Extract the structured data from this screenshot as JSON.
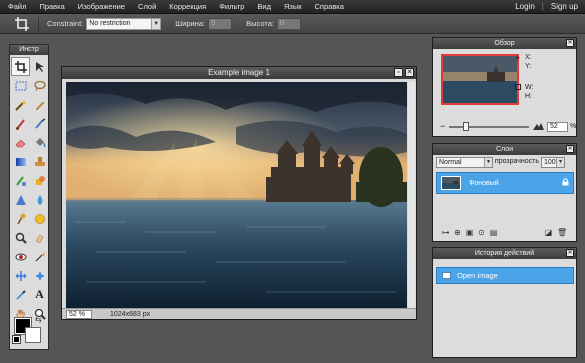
{
  "menu": {
    "items": [
      "Файл",
      "Правка",
      "Изображение",
      "Слой",
      "Коррекция",
      "Фильтр",
      "Вид",
      "Язык",
      "Справка"
    ],
    "login": "Login",
    "separator": "|",
    "signup": "Sign up"
  },
  "options": {
    "constraint_label": "Constraint:",
    "constraint_value": "No restriction",
    "width_label": "Ширина:",
    "width_value": "0",
    "height_label": "Высота:",
    "height_value": "0"
  },
  "tools": {
    "title": "Инстр",
    "icons": [
      "crop-icon",
      "move-icon",
      "marquee-icon",
      "lasso-icon",
      "wand-icon",
      "pencil-icon",
      "brush-icon",
      "clone-icon",
      "eraser-icon",
      "bucket-icon",
      "gradient-icon",
      "stamp-icon",
      "color-replace-icon",
      "drawing-icon",
      "sharpen-icon",
      "blur-icon",
      "dodge-icon",
      "burn-icon",
      "sponge-icon",
      "smudge-icon",
      "eyedropper-icon",
      "spot-heal-icon",
      "red-eye-icon",
      "bloat-icon",
      "pinch-icon",
      "text-icon",
      "hand-icon",
      "zoom-icon",
      "line-icon",
      "type-icon"
    ],
    "foreground_color": "#000000",
    "background_color": "#ffffff"
  },
  "image_window": {
    "title": "Example image 1",
    "zoom": "52",
    "zoom_unit": "%",
    "dimensions": "1024x683 px"
  },
  "navigator": {
    "title": "Обзор",
    "x_label": "X:",
    "y_label": "Y:",
    "w_label": "W:",
    "h_label": "H:",
    "zoom": "52",
    "zoom_unit": "%",
    "zoom_fraction": 0.18
  },
  "layers": {
    "title": "Слои",
    "blend_mode": "Normal",
    "opacity_label": "Непрозрачность:",
    "opacity_value": "100",
    "layer_name": "Фоновый"
  },
  "history": {
    "title": "История действий",
    "items": [
      "Open image"
    ]
  },
  "colors": {
    "accent": "#4ba3e8",
    "thumb_border": "#e23b3b"
  }
}
